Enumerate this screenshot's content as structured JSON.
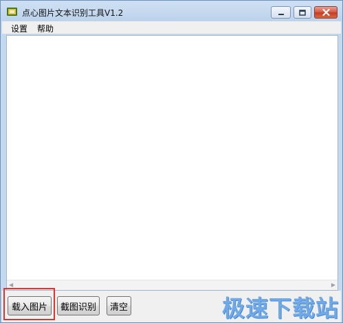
{
  "window": {
    "title": "点心图片文本识别工具V1.2"
  },
  "menu": {
    "items": [
      "设置",
      "帮助"
    ]
  },
  "buttons": {
    "load_image": "载入图片",
    "screenshot_ocr": "截图识别",
    "clear": "清空"
  },
  "text_area": {
    "value": ""
  },
  "watermark": "极速下载站",
  "colors": {
    "highlight": "#e0312b",
    "watermark": "#6fa9e8",
    "close_button": "#c43b23"
  }
}
